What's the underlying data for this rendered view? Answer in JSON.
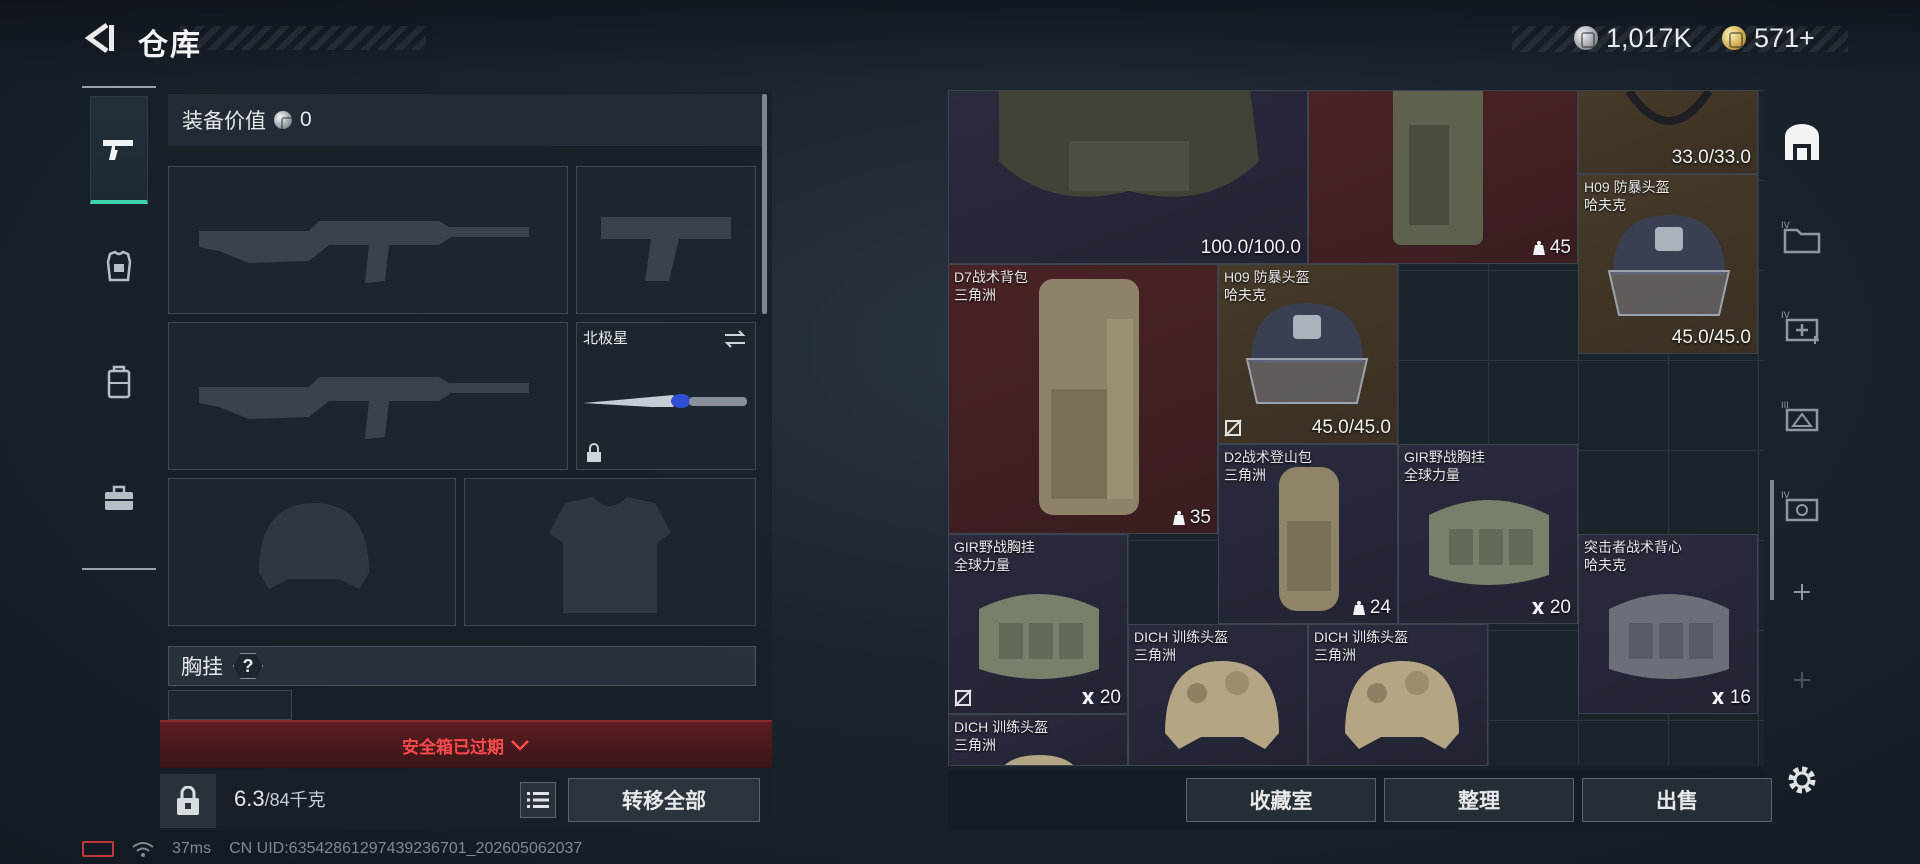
{
  "header": {
    "title": "仓库",
    "currency_silver": "1,017K",
    "currency_gold": "571+"
  },
  "loadout": {
    "value_label": "装备价值",
    "value_amount": "0",
    "melee_name": "北极星",
    "section_label": "胸挂",
    "help": "?",
    "expired_text": "安全箱已过期",
    "weight_current": "6.3",
    "weight_max": "/84千克",
    "transfer_all": "转移全部"
  },
  "status": {
    "ping": "37ms",
    "uid": "CN UID:63542861297439236701_202605062037"
  },
  "stash": {
    "items": [
      {
        "name": "",
        "maker": "",
        "value": "100.0/100.0"
      },
      {
        "name": "",
        "maker": "",
        "value": "45"
      },
      {
        "name": "",
        "maker": "",
        "value": "33.0/33.0"
      },
      {
        "name": "H09 防暴头盔",
        "maker": "哈夫克",
        "value": "45.0/45.0"
      },
      {
        "name": "D7战术背包",
        "maker": "三角洲",
        "value": "35"
      },
      {
        "name": "H09 防暴头盔",
        "maker": "哈夫克",
        "value": "45.0/45.0"
      },
      {
        "name": "D2战术登山包",
        "maker": "三角洲",
        "value": "24"
      },
      {
        "name": "GIR野战胸挂",
        "maker": "全球力量",
        "value": "20"
      },
      {
        "name": "GIR野战胸挂",
        "maker": "全球力量",
        "value": "20"
      },
      {
        "name": "突击者战术背心",
        "maker": "哈夫克",
        "value": "16"
      },
      {
        "name": "DICH 训练头盔",
        "maker": "三角洲",
        "value": ""
      },
      {
        "name": "DICH 训练头盔",
        "maker": "三角洲",
        "value": ""
      },
      {
        "name": "DICH 训练头盔",
        "maker": "三角洲",
        "value": ""
      }
    ]
  },
  "actions": {
    "collection": "收藏室",
    "organize": "整理",
    "sell": "出售"
  },
  "colors": {
    "accent_green": "#3fd1a8",
    "expired_red": "#ff4b4b",
    "rarity_purple": "#2a2b3e",
    "rarity_red": "#4a2326",
    "rarity_gold": "#463a2a"
  }
}
